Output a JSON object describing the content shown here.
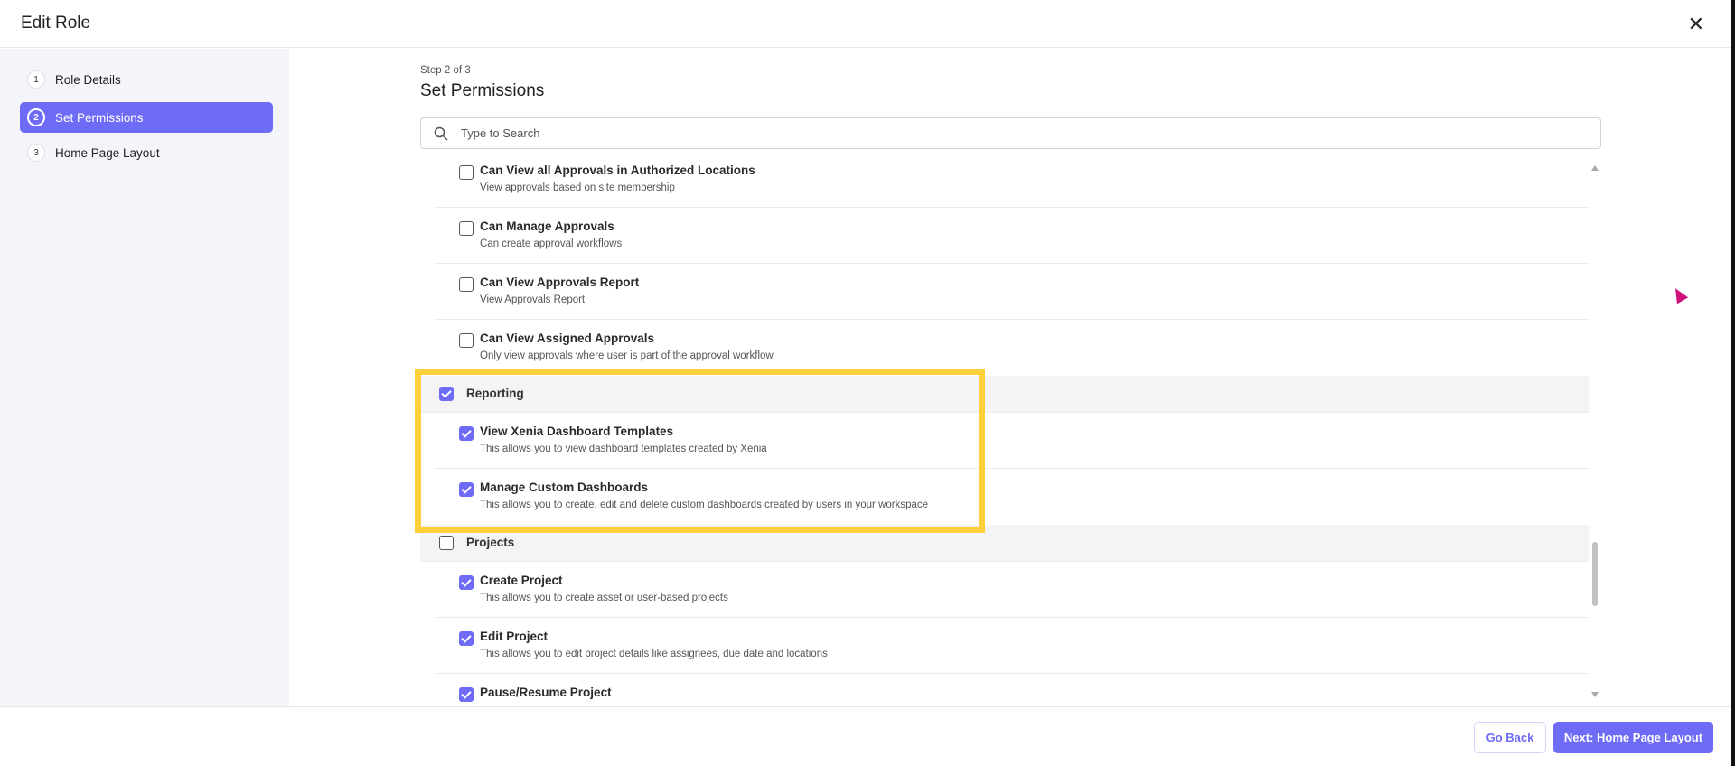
{
  "header": {
    "title": "Edit Role",
    "close_icon": "close-icon"
  },
  "steps": [
    {
      "num": "1",
      "label": "Role Details"
    },
    {
      "num": "2",
      "label": "Set Permissions"
    },
    {
      "num": "3",
      "label": "Home Page Layout"
    }
  ],
  "main": {
    "step_label": "Step 2 of 3",
    "title": "Set Permissions",
    "search_placeholder": "Type to Search"
  },
  "permissions": {
    "approvals": [
      {
        "title": "Can View all Approvals in Authorized Locations",
        "desc": "View approvals based on site membership",
        "checked": false
      },
      {
        "title": "Can Manage Approvals",
        "desc": "Can create approval workflows",
        "checked": false
      },
      {
        "title": "Can View Approvals Report",
        "desc": "View Approvals Report",
        "checked": false
      },
      {
        "title": "Can View Assigned Approvals",
        "desc": "Only view approvals where user is part of the approval workflow",
        "checked": false
      }
    ],
    "reporting": {
      "label": "Reporting",
      "checked": true,
      "items": [
        {
          "title": "View Xenia Dashboard Templates",
          "desc": "This allows you to view dashboard templates created by Xenia",
          "checked": true
        },
        {
          "title": "Manage Custom Dashboards",
          "desc": "This allows you to create, edit and delete custom dashboards created by users in your workspace",
          "checked": true
        }
      ]
    },
    "projects": {
      "label": "Projects",
      "checked": false,
      "items": [
        {
          "title": "Create Project",
          "desc": "This allows you to create asset or user-based projects",
          "checked": true
        },
        {
          "title": "Edit Project",
          "desc": "This allows you to edit project details like assignees, due date and locations",
          "checked": true
        },
        {
          "title": "Pause/Resume Project",
          "desc": "",
          "checked": true
        }
      ]
    }
  },
  "footer": {
    "back_label": "Go Back",
    "next_label": "Next: Home Page Layout"
  },
  "colors": {
    "accent": "#6e6bf7",
    "highlight": "#fdd03b"
  }
}
